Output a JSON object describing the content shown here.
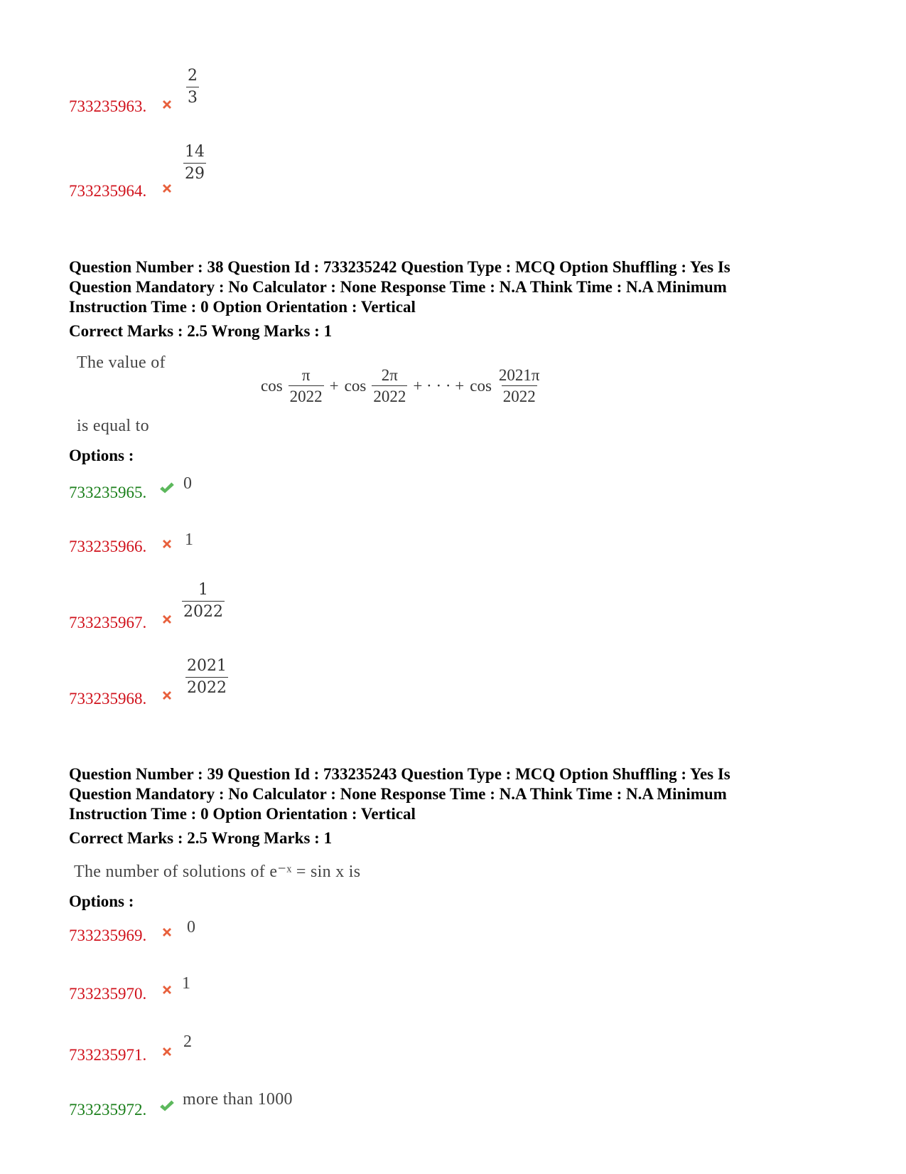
{
  "colors": {
    "wrong": "#d0111b",
    "correct": "#1a7f1a",
    "wrong_icon": "#e8603c",
    "correct_icon": "#5cb85c"
  },
  "icons": {
    "wrong": "cross-icon",
    "correct": "check-icon"
  },
  "previous_options": [
    {
      "id": "733235963.",
      "status": "wrong",
      "numerator": "2",
      "denominator": "3"
    },
    {
      "id": "733235964.",
      "status": "wrong",
      "numerator": "14",
      "denominator": "29"
    }
  ],
  "questions": [
    {
      "meta_lines": [
        "Question Number : 38 Question Id : 733235242 Question Type : MCQ Option Shuffling : Yes Is",
        "Question Mandatory : No Calculator : None Response Time : N.A Think Time : N.A Minimum",
        "Instruction Time : 0 Option Orientation : Vertical"
      ],
      "marks": "Correct Marks : 2.5 Wrong Marks : 1",
      "text_before": "The value of",
      "formula": {
        "terms": [
          {
            "func": "cos",
            "numerator": "π",
            "denominator": "2022"
          },
          {
            "op": "+"
          },
          {
            "func": "cos",
            "numerator": "2π",
            "denominator": "2022"
          },
          {
            "op": "+ · · · +"
          },
          {
            "func": "cos",
            "numerator": "2021π",
            "denominator": "2022"
          }
        ]
      },
      "text_after": "is equal to",
      "options_label": "Options :",
      "options": [
        {
          "id": "733235965.",
          "status": "correct",
          "value": "0"
        },
        {
          "id": "733235966.",
          "status": "wrong",
          "value": "1"
        },
        {
          "id": "733235967.",
          "status": "wrong",
          "numerator": "1",
          "denominator": "2022"
        },
        {
          "id": "733235968.",
          "status": "wrong",
          "numerator": "2021",
          "denominator": "2022"
        }
      ]
    },
    {
      "meta_lines": [
        "Question Number : 39 Question Id : 733235243 Question Type : MCQ Option Shuffling : Yes Is",
        "Question Mandatory : No Calculator : None Response Time : N.A Think Time : N.A Minimum",
        "Instruction Time : 0 Option Orientation : Vertical"
      ],
      "marks": "Correct Marks : 2.5 Wrong Marks : 1",
      "text": "The number of solutions of e⁻ˣ = sin x is",
      "options_label": "Options :",
      "options": [
        {
          "id": "733235969.",
          "status": "wrong",
          "value": "0"
        },
        {
          "id": "733235970.",
          "status": "wrong",
          "value": "1"
        },
        {
          "id": "733235971.",
          "status": "wrong",
          "value": "2"
        },
        {
          "id": "733235972.",
          "status": "correct",
          "value": "more than 1000"
        }
      ]
    }
  ]
}
